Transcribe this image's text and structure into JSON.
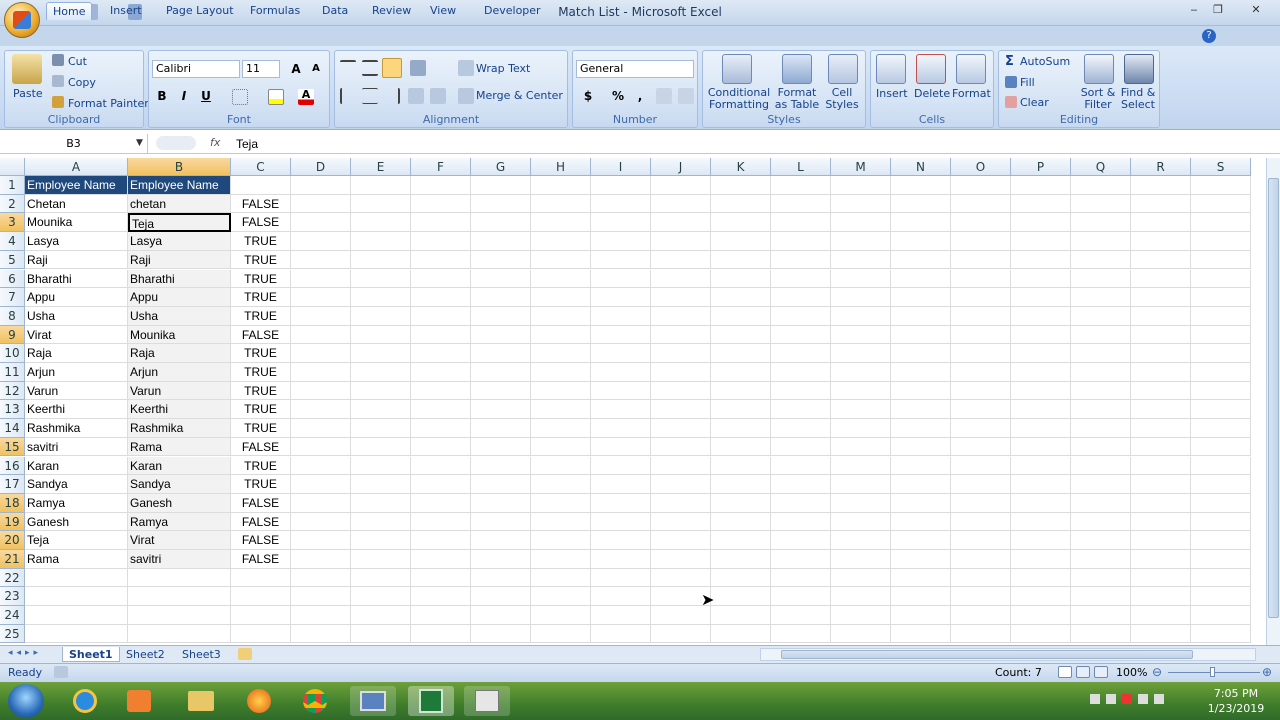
{
  "window": {
    "title": "Match List - Microsoft Excel"
  },
  "tabs": [
    "Home",
    "Insert",
    "Page Layout",
    "Formulas",
    "Data",
    "Review",
    "View",
    "Developer"
  ],
  "ribbon": {
    "clipboard": {
      "label": "Clipboard",
      "paste": "Paste",
      "cut": "Cut",
      "copy": "Copy",
      "format_painter": "Format Painter"
    },
    "font": {
      "label": "Font",
      "name": "Calibri",
      "size": "11",
      "bold": "B",
      "italic": "I",
      "underline": "U"
    },
    "alignment": {
      "label": "Alignment",
      "wrap_text": "Wrap Text",
      "merge_center": "Merge & Center"
    },
    "number": {
      "label": "Number",
      "format": "General",
      "currency": "$",
      "percent": "%",
      "comma": ","
    },
    "styles": {
      "label": "Styles",
      "conditional": "Conditional Formatting",
      "format_table": "Format as Table",
      "cell_styles": "Cell Styles"
    },
    "cells": {
      "label": "Cells",
      "insert": "Insert",
      "delete": "Delete",
      "format": "Format"
    },
    "editing": {
      "label": "Editing",
      "autosum": "AutoSum",
      "fill": "Fill",
      "clear": "Clear",
      "sort_filter": "Sort & Filter",
      "find_select": "Find & Select"
    }
  },
  "formula_bar": {
    "name_box": "B3",
    "fx": "fx",
    "content": "Teja"
  },
  "columns": [
    "A",
    "B",
    "C",
    "D",
    "E",
    "F",
    "G",
    "H",
    "I",
    "J",
    "K",
    "L",
    "M",
    "N",
    "O",
    "P",
    "Q",
    "R",
    "S"
  ],
  "rows": [
    {
      "n": "1",
      "a": "Employee Name",
      "b": "Employee Name",
      "c": ""
    },
    {
      "n": "2",
      "a": "Chetan",
      "b": "chetan",
      "c": "FALSE"
    },
    {
      "n": "3",
      "a": "Mounika",
      "b": "Teja",
      "c": "FALSE"
    },
    {
      "n": "4",
      "a": "Lasya",
      "b": "Lasya",
      "c": "TRUE"
    },
    {
      "n": "5",
      "a": "Raji",
      "b": "Raji",
      "c": "TRUE"
    },
    {
      "n": "6",
      "a": "Bharathi",
      "b": "Bharathi",
      "c": "TRUE"
    },
    {
      "n": "7",
      "a": "Appu",
      "b": "Appu",
      "c": "TRUE"
    },
    {
      "n": "8",
      "a": "Usha",
      "b": "Usha",
      "c": "TRUE"
    },
    {
      "n": "9",
      "a": "Virat",
      "b": "Mounika",
      "c": "FALSE"
    },
    {
      "n": "10",
      "a": "Raja",
      "b": "Raja",
      "c": "TRUE"
    },
    {
      "n": "11",
      "a": "Arjun",
      "b": "Arjun",
      "c": "TRUE"
    },
    {
      "n": "12",
      "a": "Varun",
      "b": "Varun",
      "c": "TRUE"
    },
    {
      "n": "13",
      "a": "Keerthi",
      "b": "Keerthi",
      "c": "TRUE"
    },
    {
      "n": "14",
      "a": "Rashmika",
      "b": "Rashmika",
      "c": "TRUE"
    },
    {
      "n": "15",
      "a": "savitri",
      "b": "Rama",
      "c": "FALSE"
    },
    {
      "n": "16",
      "a": "Karan",
      "b": "Karan",
      "c": "TRUE"
    },
    {
      "n": "17",
      "a": "Sandya",
      "b": "Sandya",
      "c": "TRUE"
    },
    {
      "n": "18",
      "a": "Ramya",
      "b": "Ganesh",
      "c": "FALSE"
    },
    {
      "n": "19",
      "a": "Ganesh",
      "b": "Ramya",
      "c": "FALSE"
    },
    {
      "n": "20",
      "a": "Teja",
      "b": "Virat",
      "c": "FALSE"
    },
    {
      "n": "21",
      "a": "Rama",
      "b": "savitri",
      "c": "FALSE"
    },
    {
      "n": "22",
      "a": "",
      "b": "",
      "c": ""
    },
    {
      "n": "23",
      "a": "",
      "b": "",
      "c": ""
    },
    {
      "n": "24",
      "a": "",
      "b": "",
      "c": ""
    },
    {
      "n": "25",
      "a": "",
      "b": "",
      "c": ""
    }
  ],
  "highlighted_rows": [
    "3",
    "9",
    "15",
    "18",
    "19",
    "20",
    "21"
  ],
  "sheets": [
    "Sheet1",
    "Sheet2",
    "Sheet3"
  ],
  "status": {
    "ready": "Ready",
    "count": "Count: 7",
    "zoom": "100%"
  },
  "clock": {
    "time": "7:05 PM",
    "date": "1/23/2019"
  },
  "colors": {
    "header_fill": "#1f497d",
    "selection": "#f1c15f",
    "ribbon": "#c9dbf2"
  }
}
